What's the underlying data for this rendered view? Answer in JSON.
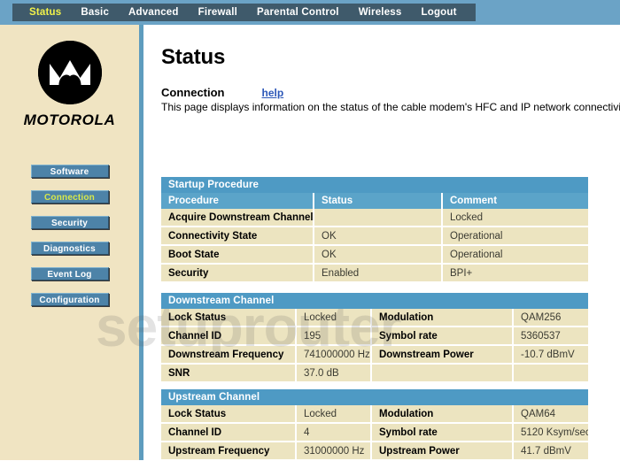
{
  "topnav": {
    "items": [
      {
        "label": "Status",
        "active": true
      },
      {
        "label": "Basic",
        "active": false
      },
      {
        "label": "Advanced",
        "active": false
      },
      {
        "label": "Firewall",
        "active": false
      },
      {
        "label": "Parental Control",
        "active": false
      },
      {
        "label": "Wireless",
        "active": false
      },
      {
        "label": "Logout",
        "active": false
      }
    ]
  },
  "sidebar": {
    "brand": "MOTOROLA",
    "buttons": [
      {
        "label": "Software",
        "active": false
      },
      {
        "label": "Connection",
        "active": true
      },
      {
        "label": "Security",
        "active": false
      },
      {
        "label": "Diagnostics",
        "active": false
      },
      {
        "label": "Event Log",
        "active": false
      },
      {
        "label": "Configuration",
        "active": false
      }
    ]
  },
  "main": {
    "page_title": "Status",
    "subhead": "Connection",
    "help_label": "help",
    "description": "This page displays information on the status of the cable modem's HFC and IP network connectivity."
  },
  "watermark": "setuprouter",
  "tables": {
    "startup": {
      "section_title": "Startup Procedure",
      "columns": [
        "Procedure",
        "Status",
        "Comment"
      ],
      "rows": [
        [
          "Acquire Downstream Channel",
          "",
          "Locked"
        ],
        [
          "Connectivity State",
          "OK",
          "Operational"
        ],
        [
          "Boot State",
          "OK",
          "Operational"
        ],
        [
          "Security",
          "Enabled",
          "BPI+"
        ]
      ]
    },
    "downstream": {
      "section_title": "Downstream Channel",
      "rows": [
        [
          "Lock Status",
          "Locked",
          "Modulation",
          "QAM256"
        ],
        [
          "Channel ID",
          "195",
          "Symbol rate",
          "5360537"
        ],
        [
          "Downstream Frequency",
          "741000000 Hz",
          "Downstream Power",
          "-10.7 dBmV"
        ],
        [
          "SNR",
          "37.0 dB",
          "",
          ""
        ]
      ]
    },
    "upstream": {
      "section_title": "Upstream Channel",
      "rows": [
        [
          "Lock Status",
          "Locked",
          "Modulation",
          "QAM64"
        ],
        [
          "Channel ID",
          "4",
          "Symbol rate",
          "5120 Ksym/sec"
        ],
        [
          "Upstream Frequency",
          "31000000 Hz",
          "Upstream Power",
          "41.7 dBmV"
        ]
      ]
    }
  },
  "colors": {
    "nav_bar": "#6ba3c6",
    "nav_inner": "#3f5a6b",
    "nav_active_text": "#f2f24a",
    "sidebar_bg": "#f0e4c2",
    "button_bg": "#4d83a8",
    "section_header": "#4e9ac4",
    "column_header": "#5ba4c9",
    "cell_bg": "#ece4c0",
    "link": "#2d58b8"
  }
}
